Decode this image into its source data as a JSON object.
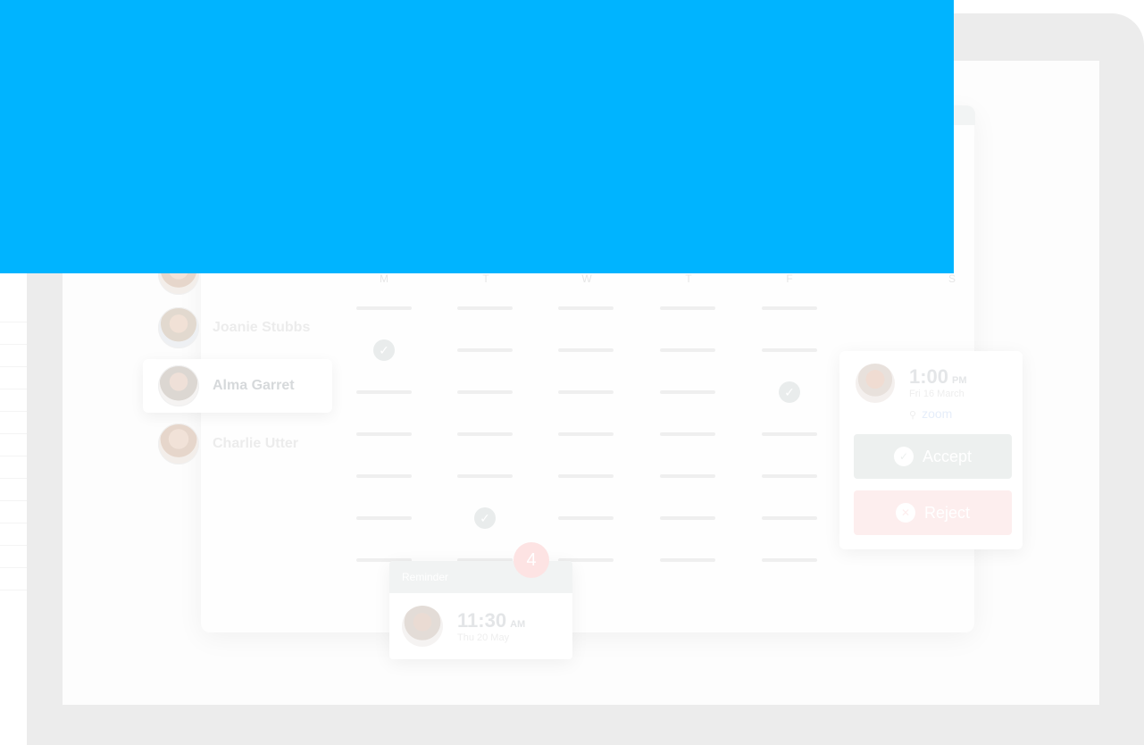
{
  "people": [
    {
      "name": ""
    },
    {
      "name": "Joanie Stubbs"
    },
    {
      "name": "Alma Garret"
    },
    {
      "name": "Charlie Utter"
    }
  ],
  "days": [
    "M",
    "T",
    "W",
    "T",
    "F",
    "S"
  ],
  "grid_checks": [
    {
      "row": 1,
      "col": 0
    },
    {
      "row": 2,
      "col": 4
    },
    {
      "row": 5,
      "col": 1
    }
  ],
  "request": {
    "time": "1:00",
    "ampm": "PM",
    "date": "Fri 16 March",
    "location": "zoom",
    "accept_label": "Accept",
    "reject_label": "Reject"
  },
  "reminder": {
    "title": "Reminder",
    "count": "4",
    "time": "11:30",
    "ampm": "AM",
    "date": "Thu 20 May"
  },
  "colors": {
    "overlay": "#00b4ff",
    "frame": "#ececec",
    "accept": "#edf0ef",
    "reject": "#fdeeee"
  }
}
